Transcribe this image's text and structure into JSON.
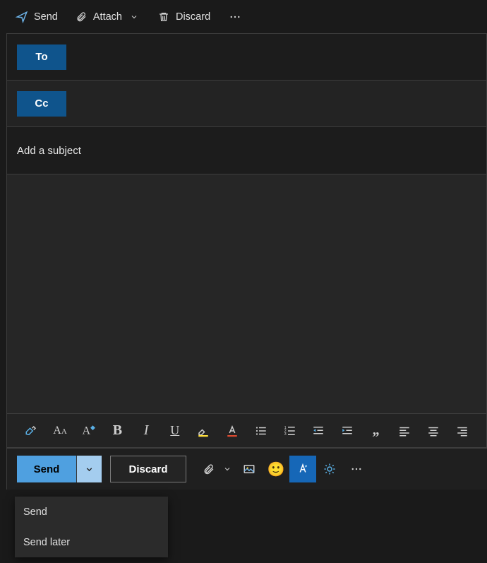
{
  "top_toolbar": {
    "send_label": "Send",
    "attach_label": "Attach",
    "discard_label": "Discard"
  },
  "recipients": {
    "to_label": "To",
    "cc_label": "Cc"
  },
  "subject": {
    "placeholder": "Add a subject"
  },
  "bottom_toolbar": {
    "send_label": "Send",
    "discard_label": "Discard"
  },
  "send_menu": {
    "items": [
      {
        "label": "Send"
      },
      {
        "label": "Send later"
      }
    ]
  },
  "colors": {
    "accent_blue": "#0f548c",
    "light_blue": "#4fa0e0",
    "faded_blue": "#a4cdef",
    "bg_dark": "#1a1a1a"
  }
}
